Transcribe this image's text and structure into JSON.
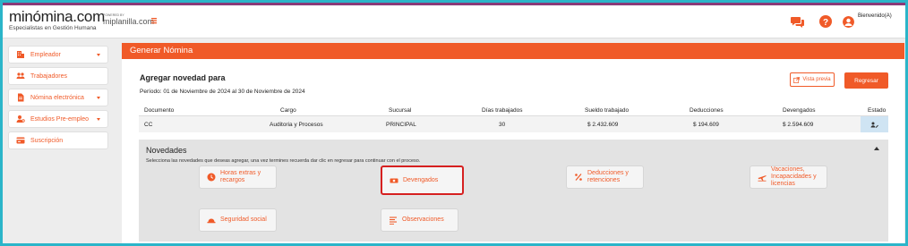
{
  "header": {
    "logo": "minómina.com",
    "logo_tagline": "Especialistas en Gestión Humana",
    "partner_small": "POWERED BY",
    "partner_name": "miplanilla.com",
    "user_label": "Bienvenido(A)"
  },
  "sidebar": {
    "items": [
      {
        "label": "Empleador",
        "icon": "building-icon",
        "has_dropdown": true
      },
      {
        "label": "Trabajadores",
        "icon": "users-icon",
        "has_dropdown": false
      },
      {
        "label": "Nómina electrónica",
        "icon": "document-icon",
        "has_dropdown": true
      },
      {
        "label": "Estudios Pre-empleo",
        "icon": "user-search-icon",
        "has_dropdown": true
      },
      {
        "label": "Suscripción",
        "icon": "card-icon",
        "has_dropdown": false
      }
    ]
  },
  "main": {
    "title": "Generar Nómina",
    "heading": "Agregar novedad para",
    "period": "Período: 01 de Noviembre de 2024 al 30 de Noviembre de 2024",
    "preview_label": "Vista previa",
    "back_label": "Regresar"
  },
  "table": {
    "headers": {
      "documento": "Documento",
      "cargo": "Cargo",
      "sucursal": "Sucursal",
      "dias": "Días trabajados",
      "sueldo": "Sueldo trabajado",
      "deducciones": "Deducciones",
      "devengados": "Devengados",
      "estado": "Estado"
    },
    "row": {
      "documento": "CC",
      "cargo": "Auditoria y Procesos",
      "sucursal": "PRINCIPAL",
      "dias": "30",
      "sueldo": "$ 2.432.609",
      "deducciones": "$ 194.609",
      "devengados": "$ 2.594.609"
    }
  },
  "novedades": {
    "title": "Novedades",
    "description": "Selecciona las novedades que deseas agregar, una vez termines recuerda dar clic en regresar para continuar con el proceso.",
    "options": {
      "horas_extras": "Horas extras y recargos",
      "devengados": "Devengados",
      "deducciones": "Deducciones y retenciones",
      "vacaciones": "Vacaciones, Incapacidades y licencias",
      "seguridad": "Seguridad social",
      "observaciones": "Observaciones"
    }
  },
  "colors": {
    "accent": "#f05a28",
    "highlight": "#d62020",
    "frame": "#2bb5c9"
  }
}
